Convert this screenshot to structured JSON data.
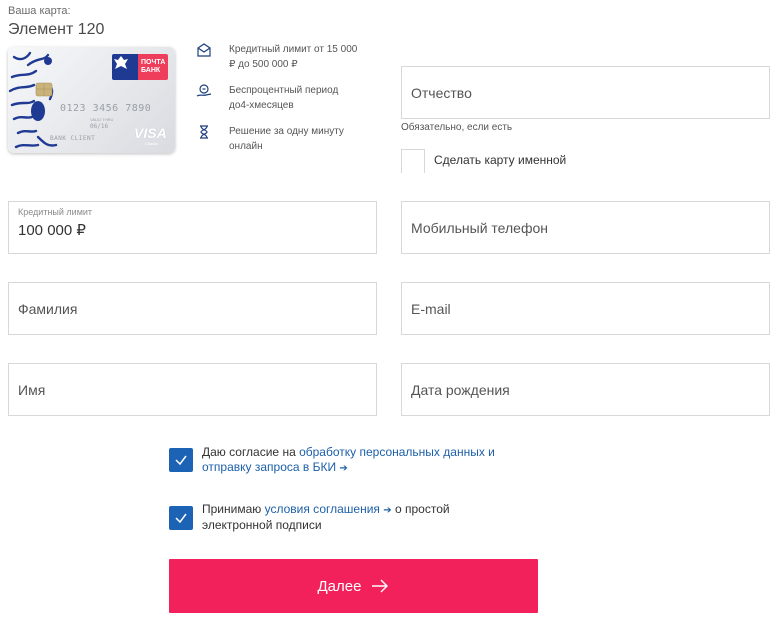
{
  "card": {
    "label": "Ваша карта:",
    "name": "Элемент 120",
    "logo_text_line1": "ПОЧТА",
    "logo_text_line2": "БАНК",
    "number": "0123 3456 7890",
    "valid_label": "VALID THRU",
    "valid_date": "06/16",
    "holder": "BANK CLIENT",
    "network": "VISA",
    "network_sub": "Classic"
  },
  "features": [
    {
      "icon": "wallet-icon",
      "text": "Кредитный лимит от 15 000 ₽ до 500 000 ₽"
    },
    {
      "icon": "coin-hand-icon",
      "text": "Беспроцентный период до4-хмесяцев"
    },
    {
      "icon": "hourglass-icon",
      "text": "Решение за одну минуту онлайн"
    }
  ],
  "form": {
    "patronymic_placeholder": "Отчество",
    "patronymic_hint": "Обязательно, если есть",
    "named_card_label": "Сделать карту именной",
    "credit_limit_label": "Кредитный лимит",
    "credit_limit_value": "100 000 ₽",
    "phone_placeholder": "Мобильный телефон",
    "surname_placeholder": "Фамилия",
    "email_placeholder": "E-mail",
    "name_placeholder": "Имя",
    "birthdate_placeholder": "Дата рождения"
  },
  "consents": {
    "first_prefix": "Даю согласие на ",
    "first_link": "обработку персональных данных и отправку запроса в БКИ",
    "first_arrow": "➔",
    "second_prefix": "Принимаю ",
    "second_link": "условия соглашения",
    "second_arrow": "➔",
    "second_suffix": " о простой электронной подписи",
    "checked_first": true,
    "checked_second": true
  },
  "next_button": {
    "label": "Далее"
  },
  "colors": {
    "accent": "#f2215b",
    "checkbox": "#1d63b5",
    "link": "#1d5fa8",
    "brand_blue": "#1f3a93",
    "brand_pink": "#ef3e5c"
  }
}
